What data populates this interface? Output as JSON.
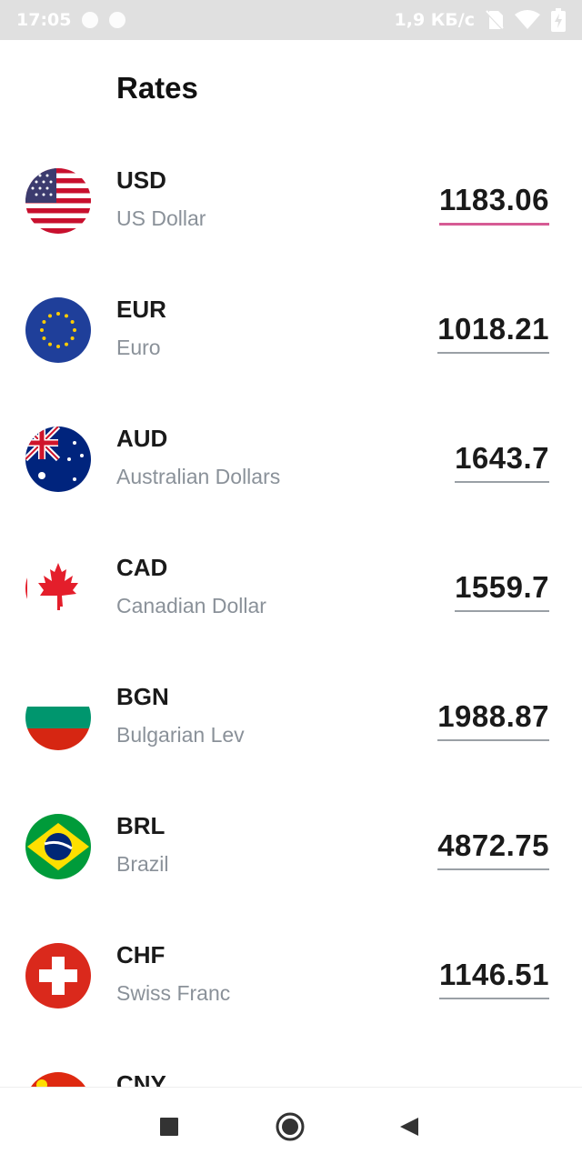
{
  "status_bar": {
    "time": "17:05",
    "network_speed": "1,9 КБ/с",
    "icons": [
      "notification-dot-icon",
      "notification-dot-icon",
      "no-sim-icon",
      "wifi-icon",
      "battery-charging-icon"
    ]
  },
  "page": {
    "title": "Rates"
  },
  "colors": {
    "focus_underline": "#d65b94",
    "underline": "#9aa0a6",
    "secondary_text": "#8a9199"
  },
  "rates": [
    {
      "code": "USD",
      "name": "US Dollar",
      "value": "1183.06",
      "flag": "us-flag-icon",
      "focused": true
    },
    {
      "code": "EUR",
      "name": "Euro",
      "value": "1018.21",
      "flag": "eu-flag-icon",
      "focused": false
    },
    {
      "code": "AUD",
      "name": "Australian Dollars",
      "value": "1643.7",
      "flag": "au-flag-icon",
      "focused": false
    },
    {
      "code": "CAD",
      "name": "Canadian Dollar",
      "value": "1559.7",
      "flag": "ca-flag-icon",
      "focused": false
    },
    {
      "code": "BGN",
      "name": "Bulgarian Lev",
      "value": "1988.87",
      "flag": "bg-flag-icon",
      "focused": false
    },
    {
      "code": "BRL",
      "name": "Brazil",
      "value": "4872.75",
      "flag": "br-flag-icon",
      "focused": false
    },
    {
      "code": "CHF",
      "name": "Swiss Franc",
      "value": "1146.51",
      "flag": "ch-flag-icon",
      "focused": false
    },
    {
      "code": "CNY",
      "name": "",
      "value": "",
      "flag": "cn-flag-icon",
      "focused": false
    }
  ],
  "nav_bar": {
    "buttons": [
      "recents-square-icon",
      "home-circle-icon",
      "back-triangle-icon"
    ]
  }
}
